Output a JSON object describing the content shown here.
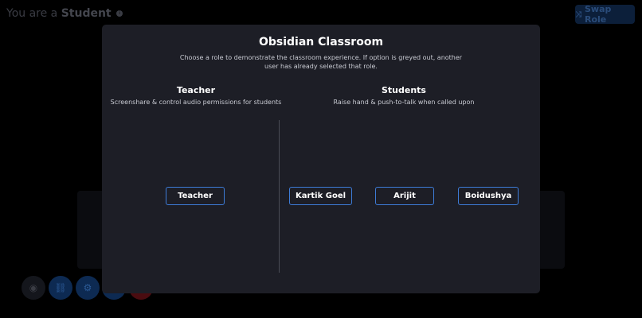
{
  "background": {
    "role_prefix": "You are a ",
    "role_name": "Student",
    "info_icon": "info-icon",
    "swap_button_label": "Swap Role",
    "swap_icon": "shuffle-icon",
    "controls": [
      {
        "icon": "camera-icon",
        "glyph": "◉"
      },
      {
        "icon": "link-icon",
        "glyph": "⛓"
      },
      {
        "icon": "gear-icon",
        "glyph": "⚙"
      },
      {
        "icon": "control-icon",
        "glyph": ""
      },
      {
        "icon": "end-call-icon",
        "glyph": ""
      }
    ]
  },
  "modal": {
    "title": "Obsidian Classroom",
    "description": "Choose a role to demonstrate the classroom experience. If option is greyed out, another user has already selected that role.",
    "teacher": {
      "heading": "Teacher",
      "subtitle": "Screenshare & control audio permissions for students",
      "button_label": "Teacher"
    },
    "students": {
      "heading": "Students",
      "subtitle": "Raise hand & push-to-talk when called upon",
      "buttons": [
        "Kartik Goel",
        "Arijit",
        "Boidushya"
      ]
    }
  },
  "colors": {
    "modal_bg": "#1d1e26",
    "accent": "#3d7bd6",
    "page_bg": "#000000"
  }
}
